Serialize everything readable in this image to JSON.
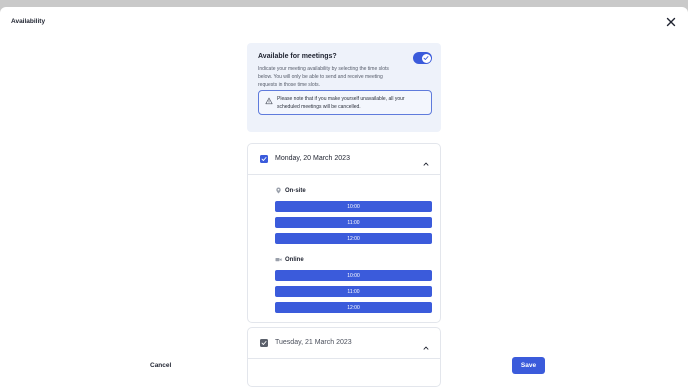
{
  "modal": {
    "title": "Availability",
    "close_icon": "close-icon"
  },
  "availability": {
    "title": "Available for meetings?",
    "description": "Indicate your meeting availability by selecting the time slots below. You will only be able to send and receive meeting requests in those time slots.",
    "toggle_on": true,
    "note": "Please note that if you make yourself unavailable, all your scheduled meetings will be cancelled."
  },
  "days": [
    {
      "label": "Monday, 20 March 2023",
      "checked": true,
      "groups": [
        {
          "label": "On-site",
          "icon": "location-pin-icon",
          "slots": [
            "10:00",
            "11:00",
            "12:00"
          ]
        },
        {
          "label": "Online",
          "icon": "video-camera-icon",
          "slots": [
            "10:00",
            "11:00",
            "12:00"
          ]
        }
      ]
    },
    {
      "label": "Tuesday, 21 March 2023",
      "checked": true
    }
  ],
  "footer": {
    "cancel_label": "Cancel",
    "save_label": "Save"
  },
  "colors": {
    "accent": "#3b5bdb",
    "info_background": "#eef2fa",
    "overlay": "#c9c9c9"
  }
}
